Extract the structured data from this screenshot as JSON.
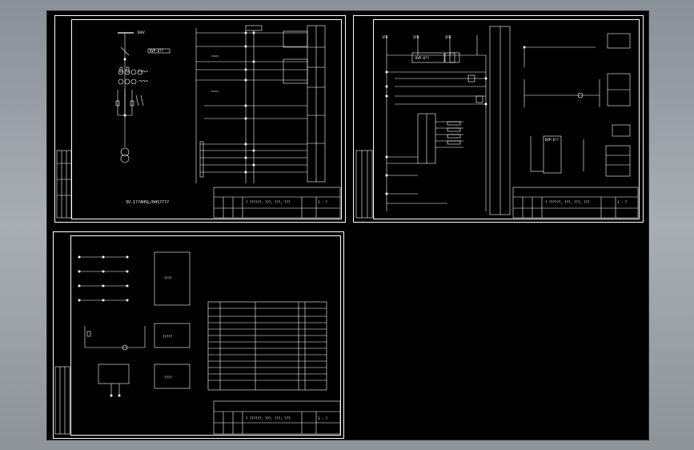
{
  "sheet1": {
    "drawing_note": "3V-1??AHSL/H4S????",
    "bus_label": "10kV",
    "relay_label": "DVP-6??",
    "title_block": {
      "title": "? ??????, ???, ???, ???",
      "scale": "1 : ?"
    }
  },
  "sheet2": {
    "relay_top": "DVP-6??",
    "relay_small": "DVP-6??",
    "fuse_labels": [
      "1FU",
      "2FU",
      "3FU"
    ],
    "title_block": {
      "title": "? ??????, ???, ???, ???",
      "scale": "1 : ?"
    }
  },
  "sheet3": {
    "box_labels": [
      "????",
      "?????",
      "????"
    ],
    "title_block": {
      "title": "? ??????, ???, ???, ???",
      "scale": "1 : ?"
    }
  }
}
